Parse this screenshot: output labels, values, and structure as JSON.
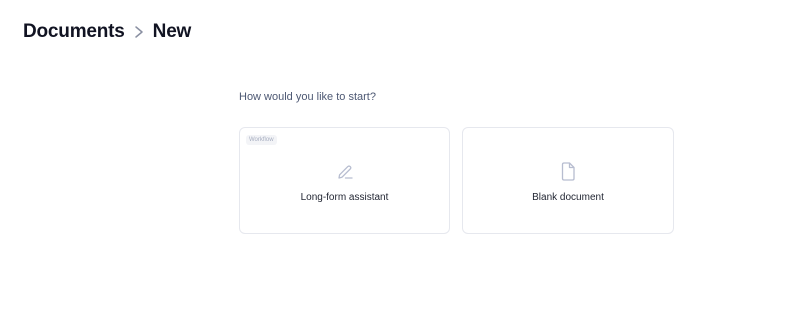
{
  "breadcrumb": {
    "root": "Documents",
    "current": "New",
    "separator_icon": "chevron-right-icon"
  },
  "prompt": "How would you like to start?",
  "options": [
    {
      "tag": "Workflow",
      "icon": "pencil-icon",
      "label": "Long-form assistant"
    },
    {
      "icon": "file-icon",
      "label": "Blank document"
    }
  ],
  "colors": {
    "title": "#111322",
    "prompt": "#4d5873",
    "card_border": "#e6e8ee",
    "icon": "#b7bdd0"
  }
}
